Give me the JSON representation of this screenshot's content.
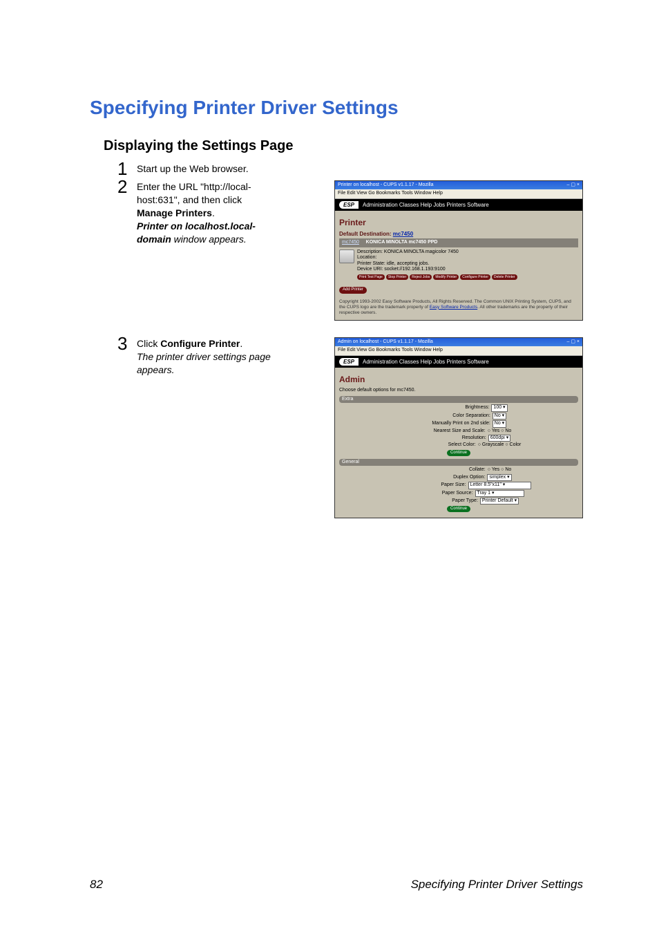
{
  "title": "Specifying Printer Driver Settings",
  "subtitle": "Displaying the Settings Page",
  "step1": {
    "num": "1",
    "text": "Start up the Web browser."
  },
  "step2": {
    "num": "2",
    "l1": "Enter the URL \"http://local-",
    "l2": "host:631\", and then click ",
    "bold": "Manage Printers",
    "period": ".",
    "it1": "Printer on localhost.local-",
    "it2": "domain",
    "it3": " window appears."
  },
  "step3": {
    "num": "3",
    "text_prefix": "Click ",
    "bold": "Configure Printer",
    "period": ".",
    "it": "The printer driver settings page appears."
  },
  "ss_common": {
    "menu": "File   Edit   View   Go   Bookmarks   Tools   Window   Help",
    "esp": "ESP",
    "nav": "Administration   Classes   Help   Jobs   Printers   Software",
    "winbtns": "– ▢ ×"
  },
  "ss1": {
    "titlebar": "Printer on localhost - CUPS v1.1.17 - Mozilla",
    "h1": "Printer",
    "defdest_label": "Default Destination: ",
    "defdest_link": "mc7450",
    "bar_link": "mc7450",
    "bar_text": "KONICA MINOLTA mc7450 PPD",
    "desc": "Description: KONICA MINOLTA magicolor 7450",
    "loc": "Location:",
    "state": "Printer State: idle, accepting jobs.",
    "device": "Device URI: socket://192.168.1.193:9100",
    "btns": [
      "Print Test Page",
      "Stop Printer",
      "Reject Jobs",
      "Modify Printer",
      "Configure Printer",
      "Delete Printer"
    ],
    "add": "Add Printer",
    "copy1": "Copyright 1993-2002 Easy Software Products, All Rights Reserved. The Common UNIX Printing System, CUPS, and the CUPS logo are the trademark property of ",
    "copy_link": "Easy Software Products",
    "copy2": ". All other trademarks are the property of their respective owners."
  },
  "ss2": {
    "titlebar": "Admin on localhost - CUPS v1.1.17 - Mozilla",
    "h1": "Admin",
    "sub": "Choose default options for mc7450.",
    "sec_extra": "Extra",
    "sec_general": "General",
    "rows_extra": [
      {
        "label": "Brightness:",
        "val": "100"
      },
      {
        "label": "Color Separation:",
        "val": "No"
      },
      {
        "label": "Manually Print on 2nd side:",
        "val": "No"
      },
      {
        "label": "Nearest Size and Scale:",
        "radios": [
          "Yes",
          "No"
        ]
      },
      {
        "label": "Resolution:",
        "val": "600dpi"
      },
      {
        "label": "Select Color:",
        "radios": [
          "Grayscale",
          "Color"
        ]
      }
    ],
    "rows_general": [
      {
        "label": "Collate:",
        "radios": [
          "Yes",
          "No"
        ]
      },
      {
        "label": "Duplex Option:",
        "val": "simplex"
      },
      {
        "label": "Paper Size:",
        "val": "Letter 8.5\"x11\""
      },
      {
        "label": "Paper Source:",
        "val": "Tray 1"
      },
      {
        "label": "Paper Type:",
        "val": "Printer Default"
      }
    ],
    "continue": "Continue"
  },
  "footer": {
    "page": "82",
    "text": "Specifying Printer Driver Settings"
  }
}
